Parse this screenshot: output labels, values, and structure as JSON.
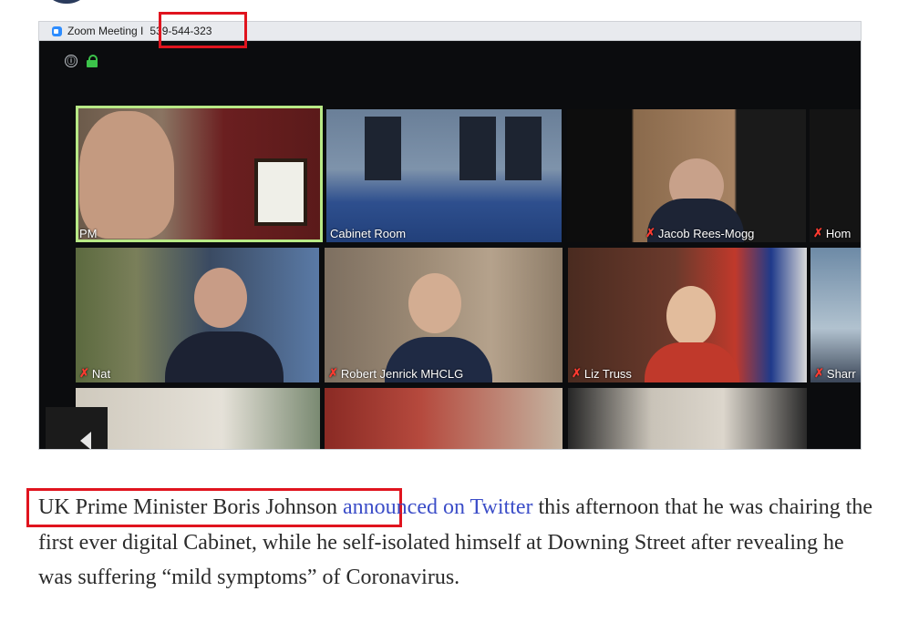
{
  "window": {
    "title_prefix": "Zoom Meeting I",
    "meeting_id": "539-544-323"
  },
  "participants": [
    {
      "name": "PM",
      "muted": false,
      "active": true
    },
    {
      "name": "Cabinet Room",
      "muted": false,
      "active": false
    },
    {
      "name": "Jacob Rees-Mogg",
      "muted": true,
      "active": false
    },
    {
      "name": "Hom",
      "muted": true,
      "active": false
    },
    {
      "name": "Nat",
      "muted": true,
      "active": false
    },
    {
      "name": "Robert Jenrick MHCLG",
      "muted": true,
      "active": false
    },
    {
      "name": "Liz Truss",
      "muted": true,
      "active": false
    },
    {
      "name": "Sharr",
      "muted": true,
      "active": false
    }
  ],
  "icons": {
    "info": "ⓘ",
    "mute": "✗"
  },
  "article": {
    "subject": "UK Prime Minister Boris Johnson",
    "link_text": "announced on Twitter",
    "body": " this afternoon that he was chairing the first ever digital Cabinet, while he self-isolated himself at Downing Street after revealing he was suffering “mild symptoms” of Coronavirus."
  },
  "colors": {
    "highlight": "#e0141e",
    "link": "#3b4dc8",
    "active_speaker": "#b8e986",
    "zoom_blue": "#2d8cff"
  }
}
